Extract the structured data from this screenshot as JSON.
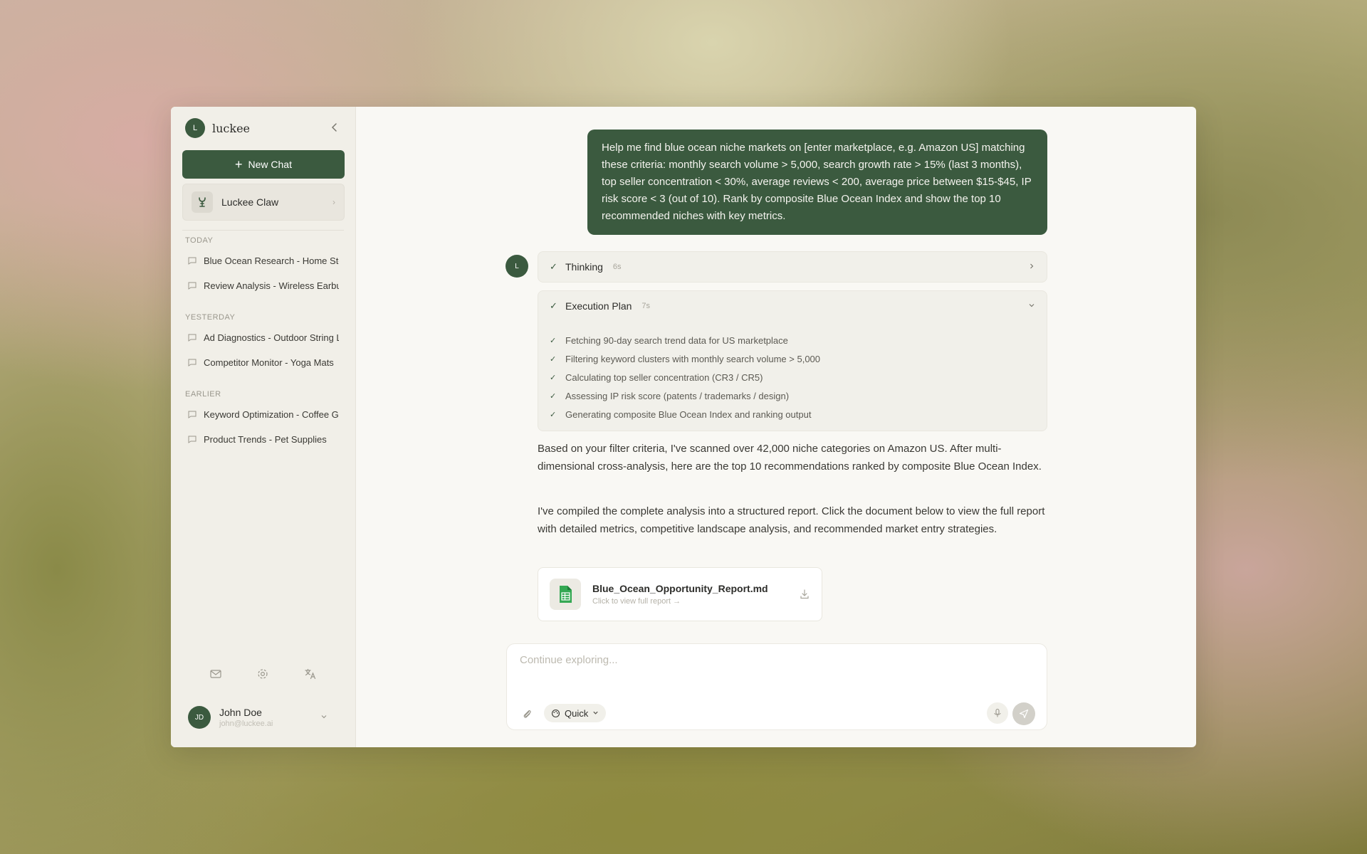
{
  "brand": {
    "logo_letter": "L",
    "name": "luckee"
  },
  "sidebar": {
    "new_chat_label": "New Chat",
    "claw_label": "Luckee Claw",
    "sections": {
      "today": "TODAY",
      "yesterday": "YESTERDAY",
      "earlier": "EARLIER"
    },
    "today_items": [
      "Blue Ocean Research - Home Storage",
      "Review Analysis - Wireless Earbuds"
    ],
    "yesterday_items": [
      "Ad Diagnostics - Outdoor String Lights",
      "Competitor Monitor - Yoga Mats"
    ],
    "earlier_items": [
      "Keyword Optimization - Coffee Grinders",
      "Product Trends - Pet Supplies"
    ],
    "user": {
      "initials": "JD",
      "name": "John Doe",
      "email": "john@luckee.ai"
    }
  },
  "chat": {
    "user_message": "Help me find blue ocean niche markets on [enter marketplace, e.g. Amazon US] matching these criteria: monthly search volume > 5,000, search growth rate > 15% (last 3 months), top seller concentration < 30%, average reviews < 200, average price between $15-$45, IP risk score < 3 (out of 10). Rank by composite Blue Ocean Index and show the top 10 recommended niches with key metrics.",
    "bot_avatar_letter": "L",
    "thinking": {
      "title": "Thinking",
      "time": "6s"
    },
    "plan": {
      "title": "Execution Plan",
      "time": "7s",
      "steps": [
        "Fetching 90-day search trend data for US marketplace",
        "Filtering keyword clusters with monthly search volume > 5,000",
        "Calculating top seller concentration (CR3 / CR5)",
        "Assessing IP risk score (patents / trademarks / design)",
        "Generating composite Blue Ocean Index and ranking output"
      ]
    },
    "answer_p1": "Based on your filter criteria, I've scanned over 42,000 niche categories on Amazon US. After multi-dimensional cross-analysis, here are the top 10 recommendations ranked by composite Blue Ocean Index.",
    "answer_p2": "I've compiled the complete analysis into a structured report. Click the document below to view the full report with detailed metrics, competitive landscape analysis, and recommended market entry strategies.",
    "file": {
      "name": "Blue_Ocean_Opportunity_Report.md",
      "subtitle": "Click to view full report →"
    }
  },
  "composer": {
    "placeholder": "Continue exploring...",
    "mode_label": "Quick"
  },
  "colors": {
    "accent": "#3b5a3f",
    "sidebar_bg": "#f1efe8",
    "main_bg": "#f9f8f4"
  }
}
